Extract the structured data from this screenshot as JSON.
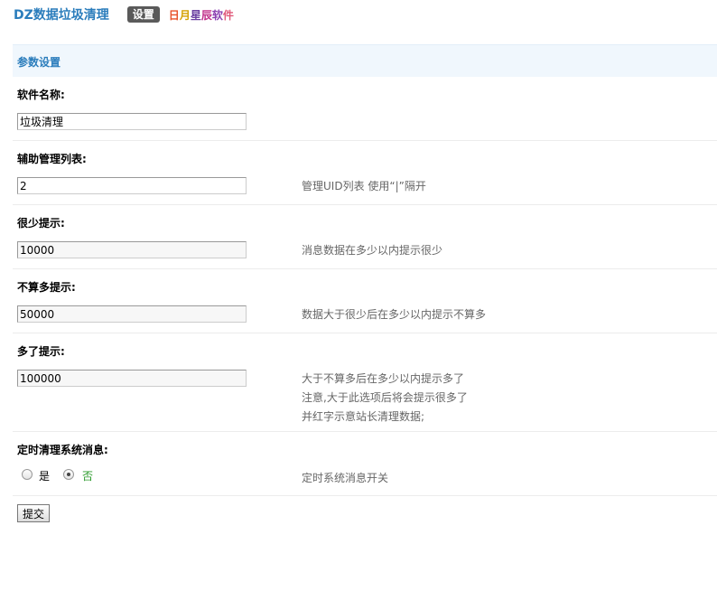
{
  "header": {
    "app_title": "DZ数据垃圾清理",
    "settings_tab": "设置",
    "brand_chars": [
      "日",
      "月",
      "星",
      "辰",
      "软",
      "件"
    ],
    "brand_colors": [
      "#e8532b",
      "#d4a100",
      "#6a3fa0",
      "#c0308a",
      "#8a3fb0",
      "#e05a7a"
    ]
  },
  "panel": {
    "title": "参数设置"
  },
  "fields": {
    "software_name": {
      "label": "软件名称:",
      "value": "垃圾清理"
    },
    "admin_list": {
      "label": "辅助管理列表:",
      "value": "2",
      "hint": "管理UID列表 使用“|”隔开"
    },
    "few_hint": {
      "label": "很少提示:",
      "value": "10000",
      "hint": "消息数据在多少以内提示很少"
    },
    "not_many_hint": {
      "label": "不算多提示:",
      "value": "50000",
      "hint": "数据大于很少后在多少以内提示不算多"
    },
    "many_hint": {
      "label": "多了提示:",
      "value": "100000",
      "hint_lines": [
        "大于不算多后在多少以内提示多了",
        "注意,大于此选项后将会提示很多了",
        "并红字示意站长清理数据;"
      ]
    },
    "timed_clean": {
      "label": "定时清理系统消息:",
      "option_yes": "是",
      "option_no": "否",
      "selected": "否",
      "selected_color": "#2a9a2a",
      "hint": "定时系统消息开关"
    }
  },
  "submit_label": "提交"
}
